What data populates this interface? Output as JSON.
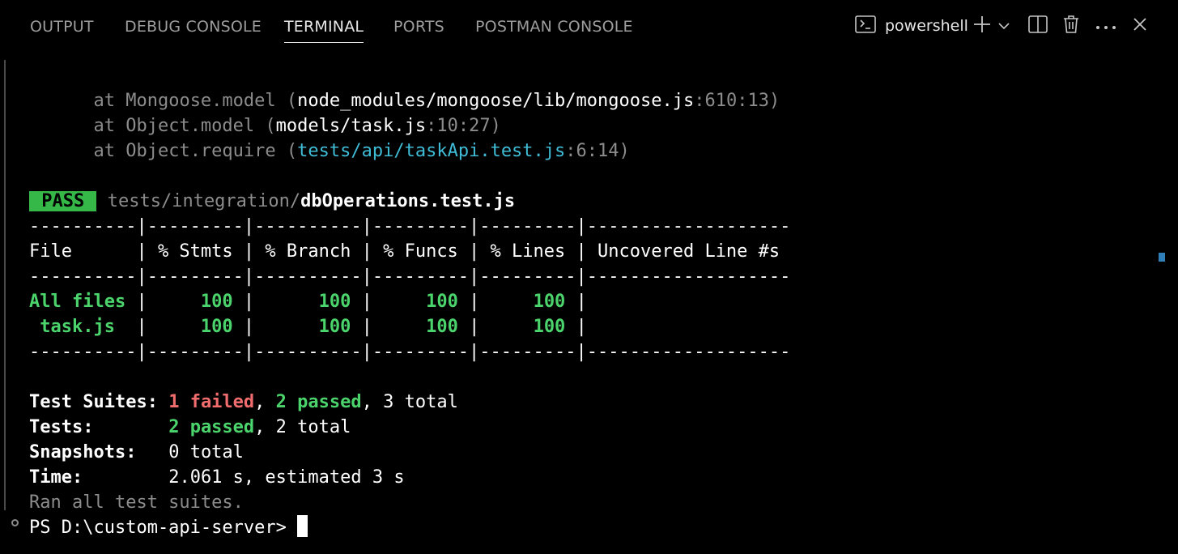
{
  "panel": {
    "tabs": [
      {
        "label": "OUTPUT",
        "active": false
      },
      {
        "label": "DEBUG CONSOLE",
        "active": false
      },
      {
        "label": "TERMINAL",
        "active": true
      },
      {
        "label": "PORTS",
        "active": false
      },
      {
        "label": "POSTMAN CONSOLE",
        "active": false
      }
    ],
    "shell_name": "powershell",
    "icons": {
      "shell": "terminal-prompt-icon",
      "new_terminal": "plus-icon",
      "dropdown": "chevron-down-icon",
      "split": "split-editor-icon",
      "trash": "trash-icon",
      "more": "ellipsis-icon",
      "close": "close-icon"
    }
  },
  "terminal": {
    "stack": [
      {
        "prefix": "      at ",
        "method": "Mongoose.model",
        "open": " (",
        "path": "node_modules/mongoose/lib/mongoose.js",
        "pos": ":610:13",
        "close": ")"
      },
      {
        "prefix": "      at ",
        "method": "Object.model",
        "open": " (",
        "path": "models/task.js",
        "pos": ":10:27",
        "close": ")"
      },
      {
        "prefix": "      at ",
        "method": "Object.require",
        "open": " (",
        "path": "tests/api/taskApi.test.js",
        "pos": ":6:14",
        "close": ")"
      }
    ],
    "pass_badge": " PASS ",
    "pass_dir": "tests/integration/",
    "pass_file": "dbOperations.test.js",
    "coverage": {
      "sep": "----------|---------|----------|---------|---------|-------------------",
      "header": "File      | % Stmts | % Branch | % Funcs | % Lines | Uncovered Line #s ",
      "rows": [
        {
          "file": "All files",
          "stmts": "100",
          "branch": "100",
          "funcs": "100",
          "lines": "100",
          "uncovered": ""
        },
        {
          "file": " task.js",
          "stmts": "100",
          "branch": "100",
          "funcs": "100",
          "lines": "100",
          "uncovered": ""
        }
      ]
    },
    "summary": {
      "suites_label": "Test Suites:",
      "suites_failed": "1 failed",
      "suites_passed": "2 passed",
      "suites_total": "3 total",
      "tests_label": "Tests:",
      "tests_passed": "2 passed",
      "tests_total": "2 total",
      "snapshots_label": "Snapshots:",
      "snapshots_value": "0 total",
      "time_label": "Time:",
      "time_value": "2.061 s, estimated 3 s",
      "ran_all": "Ran all test suites."
    },
    "prompt": "PS D:\\custom-api-server> "
  }
}
